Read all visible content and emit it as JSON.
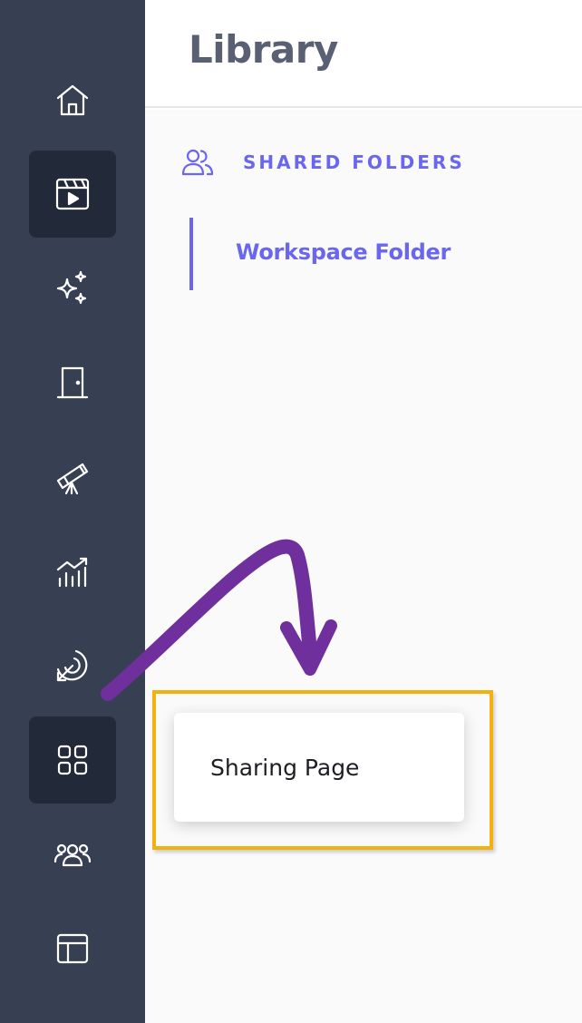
{
  "header": {
    "title": "Library"
  },
  "sidebar": {
    "items": [
      {
        "icon": "home-icon",
        "active": false
      },
      {
        "icon": "video-clapper-icon",
        "active": true
      },
      {
        "icon": "sparkles-icon",
        "active": false
      },
      {
        "icon": "door-icon",
        "active": false
      },
      {
        "icon": "telescope-icon",
        "active": false
      },
      {
        "icon": "bar-chart-trend-icon",
        "active": false
      },
      {
        "icon": "target-arrow-icon",
        "active": false
      },
      {
        "icon": "grid-apps-icon",
        "active": true
      },
      {
        "icon": "users-group-icon",
        "active": false
      },
      {
        "icon": "layout-icon",
        "active": false
      }
    ]
  },
  "main": {
    "section": {
      "label": "SHARED FOLDERS",
      "icon": "users-icon"
    },
    "folders": [
      {
        "label": "Workspace Folder"
      }
    ]
  },
  "popup_menu": {
    "items": [
      {
        "label": "Sharing Page"
      }
    ]
  },
  "annotation": {
    "arrow_color": "#6f2f9c",
    "highlight_color": "#f4b00e"
  },
  "colors": {
    "sidebar": "#373f52",
    "sidebar_active": "#222938",
    "accent": "#6a66f0"
  }
}
